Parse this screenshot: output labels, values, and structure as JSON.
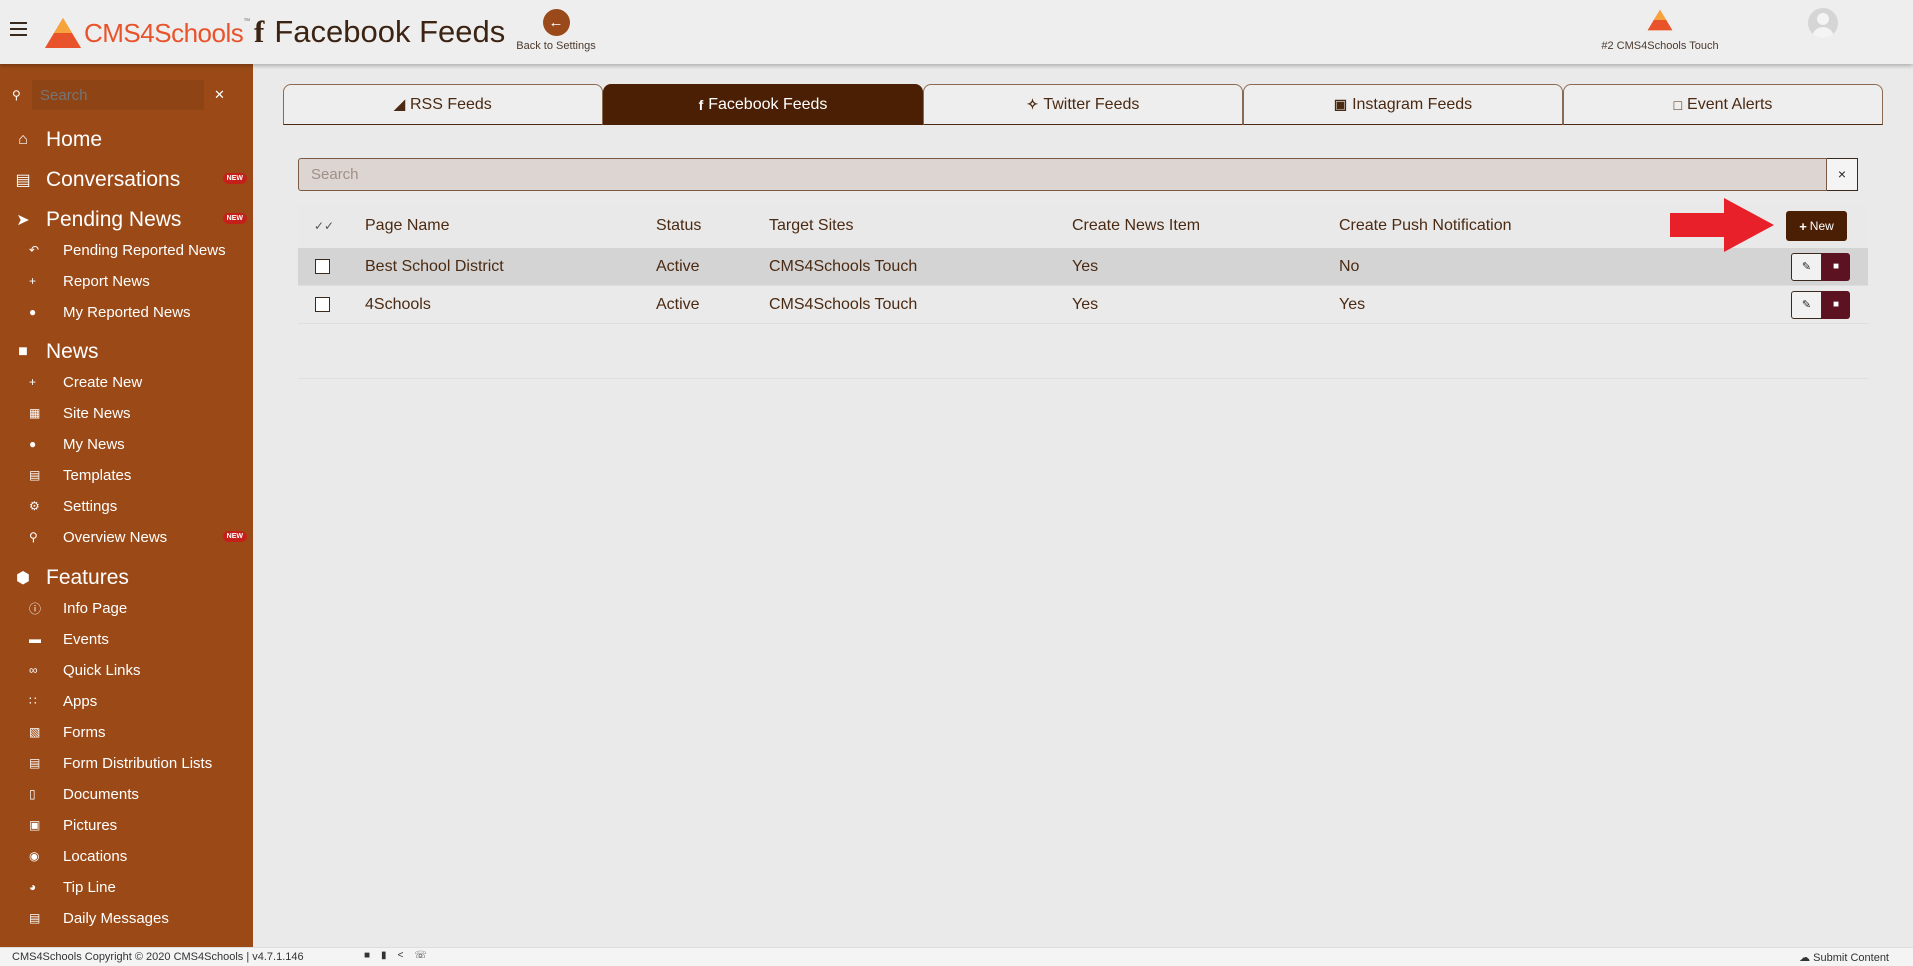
{
  "header": {
    "logo_prefix": "CMS",
    "logo_suffix": "4Schools",
    "logo_tm": "™",
    "page_title": "Facebook Feeds",
    "page_title_icon": "f",
    "back_label": "Back to Settings",
    "site_label": "#2 CMS4Schools Touch"
  },
  "sidebar": {
    "search_placeholder": "Search",
    "new_badge": "NEW",
    "sections": [
      {
        "label": "Home",
        "icon": "home-icon"
      },
      {
        "label": "Conversations",
        "icon": "chat-icon",
        "badge": true
      },
      {
        "label": "Pending News",
        "icon": "paper-plane-icon",
        "badge": true
      },
      {
        "label": "News",
        "icon": "speech-bubble-icon"
      },
      {
        "label": "Features",
        "icon": "cube-icon"
      }
    ],
    "pending_items": [
      {
        "label": "Pending Reported News",
        "icon": "reply-icon"
      },
      {
        "label": "Report News",
        "icon": "plus-icon"
      },
      {
        "label": "My Reported News",
        "icon": "user-icon"
      }
    ],
    "news_items": [
      {
        "label": "Create New",
        "icon": "plus-icon"
      },
      {
        "label": "Site News",
        "icon": "building-icon"
      },
      {
        "label": "My News",
        "icon": "user-icon"
      },
      {
        "label": "Templates",
        "icon": "template-icon"
      },
      {
        "label": "Settings",
        "icon": "gear-icon"
      },
      {
        "label": "Overview News",
        "icon": "search-icon",
        "badge": true
      }
    ],
    "feature_items": [
      {
        "label": "Info Page",
        "icon": "info-icon"
      },
      {
        "label": "Events",
        "icon": "calendar-icon"
      },
      {
        "label": "Quick Links",
        "icon": "link-icon"
      },
      {
        "label": "Apps",
        "icon": "grid-icon"
      },
      {
        "label": "Forms",
        "icon": "clipboard-icon"
      },
      {
        "label": "Form Distribution Lists",
        "icon": "list-icon"
      },
      {
        "label": "Documents",
        "icon": "document-icon"
      },
      {
        "label": "Pictures",
        "icon": "picture-icon"
      },
      {
        "label": "Locations",
        "icon": "map-pin-icon"
      },
      {
        "label": "Tip Line",
        "icon": "tip-icon"
      },
      {
        "label": "Daily Messages",
        "icon": "message-icon"
      }
    ]
  },
  "tabs": [
    {
      "label": "RSS Feeds",
      "icon": "rss-icon",
      "glyph": "◢"
    },
    {
      "label": "Facebook Feeds",
      "icon": "facebook-icon",
      "glyph": "f",
      "active": true
    },
    {
      "label": "Twitter Feeds",
      "icon": "twitter-icon",
      "glyph": "✧"
    },
    {
      "label": "Instagram Feeds",
      "icon": "instagram-icon",
      "glyph": "▣"
    },
    {
      "label": "Event Alerts",
      "icon": "calendar-icon",
      "glyph": "□"
    }
  ],
  "search": {
    "placeholder": "Search",
    "clear": "×"
  },
  "table": {
    "columns": [
      "Page Name",
      "Status",
      "Target Sites",
      "Create News Item",
      "Create Push Notification"
    ],
    "new_button": "New",
    "rows": [
      {
        "page_name": "Best School District",
        "status": "Active",
        "target_sites": "CMS4Schools Touch",
        "create_news_item": "Yes",
        "create_push": "No"
      },
      {
        "page_name": "4Schools",
        "status": "Active",
        "target_sites": "CMS4Schools Touch",
        "create_news_item": "Yes",
        "create_push": "Yes"
      }
    ]
  },
  "footer": {
    "copyright": "CMS4Schools Copyright © 2020 CMS4Schools | v4.7.1.146",
    "submit": "Submit Content"
  },
  "colors": {
    "sidebar": "#9b4a17",
    "active_tab": "#4a1f04",
    "badge": "#c4201a",
    "annotation_arrow": "#e8202a",
    "logo": "#e8532b"
  }
}
